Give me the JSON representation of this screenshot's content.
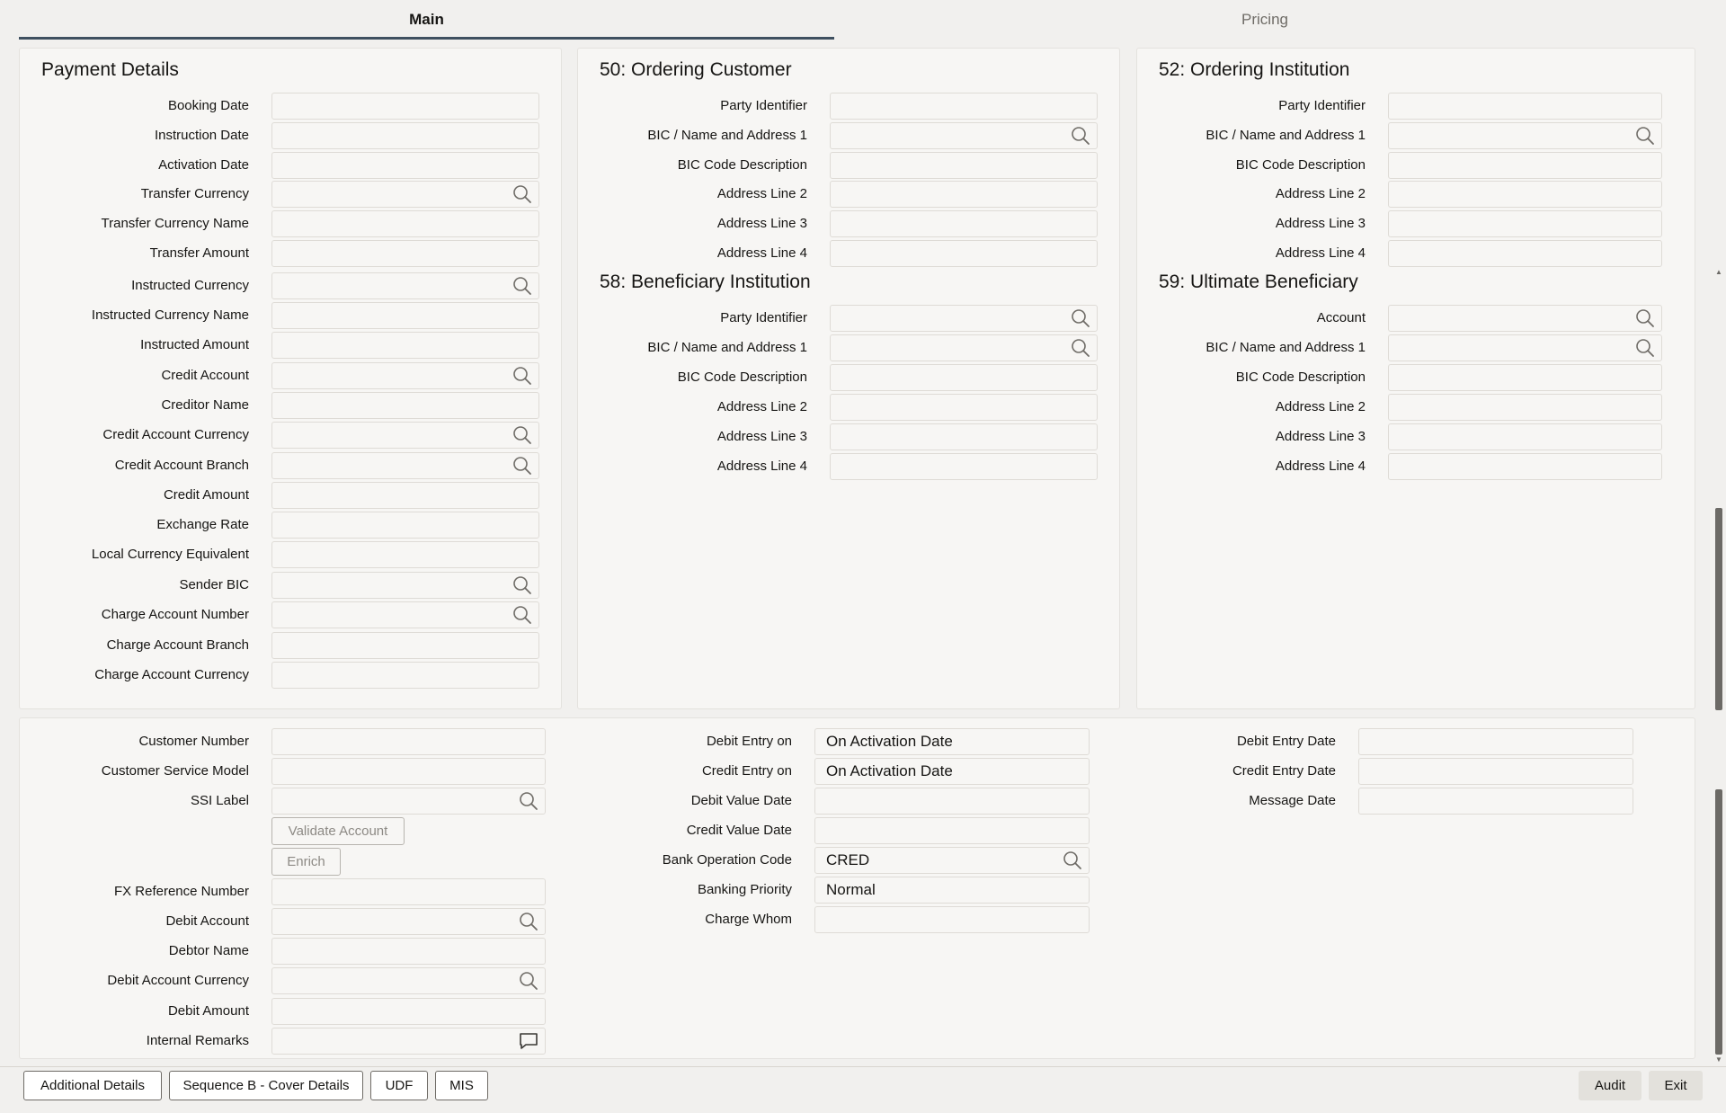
{
  "tabs": [
    {
      "label": "Main",
      "active": true
    },
    {
      "label": "Pricing",
      "active": false
    }
  ],
  "payment_details": {
    "title": "Payment Details",
    "fields": [
      {
        "label": "Booking Date",
        "lookup": false
      },
      {
        "label": "Instruction Date",
        "lookup": false
      },
      {
        "label": "Activation Date",
        "lookup": false
      },
      {
        "label": "Transfer Currency",
        "lookup": true
      },
      {
        "label": "Transfer Currency Name",
        "lookup": false
      },
      {
        "label": "Transfer Amount",
        "lookup": false
      },
      {
        "label": "Instructed Currency",
        "lookup": true
      },
      {
        "label": "Instructed Currency Name",
        "lookup": false
      },
      {
        "label": "Instructed Amount",
        "lookup": false
      },
      {
        "label": "Credit Account",
        "lookup": true
      },
      {
        "label": "Creditor Name",
        "lookup": false
      },
      {
        "label": "Credit Account Currency",
        "lookup": true
      },
      {
        "label": "Credit Account Branch",
        "lookup": true
      },
      {
        "label": "Credit Amount",
        "lookup": false
      },
      {
        "label": "Exchange Rate",
        "lookup": false
      },
      {
        "label": "Local Currency Equivalent",
        "lookup": false
      },
      {
        "label": "Sender BIC",
        "lookup": true
      },
      {
        "label": "Charge Account Number",
        "lookup": true
      },
      {
        "label": "Charge Account Branch",
        "lookup": false
      },
      {
        "label": "Charge Account Currency",
        "lookup": false
      }
    ]
  },
  "ordering_customer": {
    "title": "50: Ordering Customer",
    "fields": [
      {
        "label": "Party Identifier",
        "lookup": false
      },
      {
        "label": "BIC / Name and Address 1",
        "lookup": true
      },
      {
        "label": "BIC Code Description",
        "lookup": false
      },
      {
        "label": "Address Line 2",
        "lookup": false
      },
      {
        "label": "Address Line 3",
        "lookup": false
      },
      {
        "label": "Address Line 4",
        "lookup": false
      }
    ]
  },
  "beneficiary_institution": {
    "title": "58: Beneficiary Institution",
    "fields": [
      {
        "label": "Party Identifier",
        "lookup": true
      },
      {
        "label": "BIC / Name and Address 1",
        "lookup": true
      },
      {
        "label": "BIC Code Description",
        "lookup": false
      },
      {
        "label": "Address Line 2",
        "lookup": false
      },
      {
        "label": "Address Line 3",
        "lookup": false
      },
      {
        "label": "Address Line 4",
        "lookup": false
      }
    ]
  },
  "ordering_institution": {
    "title": "52: Ordering Institution",
    "fields": [
      {
        "label": "Party Identifier",
        "lookup": false
      },
      {
        "label": "BIC / Name and Address 1",
        "lookup": true
      },
      {
        "label": "BIC Code Description",
        "lookup": false
      },
      {
        "label": "Address Line 2",
        "lookup": false
      },
      {
        "label": "Address Line 3",
        "lookup": false
      },
      {
        "label": "Address Line 4",
        "lookup": false
      }
    ]
  },
  "ultimate_beneficiary": {
    "title": "59: Ultimate Beneficiary",
    "fields": [
      {
        "label": "Account",
        "lookup": true
      },
      {
        "label": "BIC / Name and Address 1",
        "lookup": true
      },
      {
        "label": "BIC Code Description",
        "lookup": false
      },
      {
        "label": "Address Line 2",
        "lookup": false
      },
      {
        "label": "Address Line 3",
        "lookup": false
      },
      {
        "label": "Address Line 4",
        "lookup": false
      }
    ]
  },
  "lower_left": {
    "fields_top": [
      {
        "label": "Customer Number",
        "lookup": false
      },
      {
        "label": "Customer Service Model",
        "lookup": false
      },
      {
        "label": "SSI Label",
        "lookup": true
      }
    ],
    "validate_button": "Validate Account",
    "enrich_button": "Enrich",
    "fields_bottom": [
      {
        "label": "FX Reference Number",
        "lookup": false
      },
      {
        "label": "Debit Account",
        "lookup": true
      },
      {
        "label": "Debtor Name",
        "lookup": false
      },
      {
        "label": "Debit Account Currency",
        "lookup": true
      },
      {
        "label": "Debit Amount",
        "lookup": false
      },
      {
        "label": "Internal Remarks",
        "lookup": false,
        "remarks": true
      }
    ]
  },
  "lower_middle": {
    "fields": [
      {
        "label": "Debit Entry on",
        "value": "On Activation Date",
        "lookup": false
      },
      {
        "label": "Credit Entry on",
        "value": "On Activation Date",
        "lookup": false
      },
      {
        "label": "Debit Value Date",
        "value": "",
        "lookup": false
      },
      {
        "label": "Credit Value Date",
        "value": "",
        "lookup": false
      },
      {
        "label": "Bank Operation Code",
        "value": "CRED",
        "lookup": true
      },
      {
        "label": "Banking Priority",
        "value": "Normal",
        "lookup": false
      },
      {
        "label": "Charge Whom",
        "value": "",
        "lookup": false
      }
    ]
  },
  "lower_right": {
    "fields": [
      {
        "label": "Debit Entry Date",
        "value": ""
      },
      {
        "label": "Credit Entry Date",
        "value": ""
      },
      {
        "label": "Message Date",
        "value": ""
      }
    ]
  },
  "footer": {
    "buttons": [
      "Additional Details",
      "Sequence B - Cover Details",
      "UDF",
      "MIS"
    ],
    "audit": "Audit",
    "exit": "Exit"
  },
  "icons": {
    "lookup": "search-icon",
    "remarks": "comment-icon"
  }
}
